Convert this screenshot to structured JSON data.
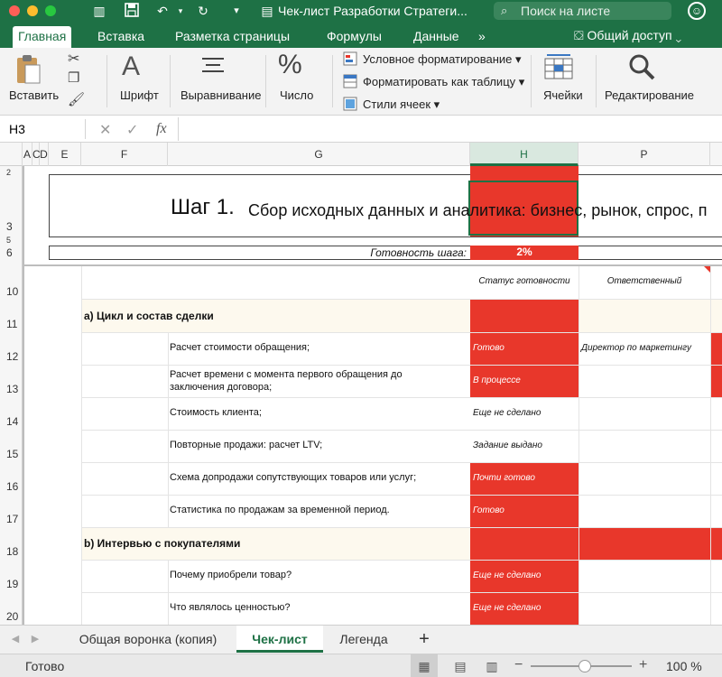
{
  "window": {
    "title": "Чек-лист Разработки Стратеги...",
    "search_placeholder": "Поиск на листе"
  },
  "ribbon_tabs": [
    "Главная",
    "Вставка",
    "Разметка страницы",
    "Формулы",
    "Данные",
    "»"
  ],
  "share_label": "Общий доступ",
  "ribbon": {
    "paste": "Вставить",
    "font": "Шрифт",
    "align": "Выравнивание",
    "number": "Число",
    "cond_format": "Условное форматирование",
    "format_table": "Форматировать как таблицу",
    "cell_styles": "Стили ячеек",
    "cells": "Ячейки",
    "editing": "Редактирование"
  },
  "formula_bar": {
    "name_box": "H3",
    "fx": "fx",
    "value": ""
  },
  "columns": [
    "A",
    "C",
    "D",
    "E",
    "F",
    "G",
    "H",
    "P"
  ],
  "sheet": {
    "heading_bold": "Шаг 1.",
    "heading_rest": "Сбор исходных данных и аналитика:  бизнес, рынок, спрос, п",
    "readiness_label": "Готовность шага:",
    "readiness_value": "2%",
    "col_status": "Статус готовности",
    "col_owner": "Ответственный",
    "section_a": "a) Цикл и состав сделки",
    "section_b": "b) Интервью с покупателями",
    "rows": [
      {
        "num": "12",
        "task": "Расчет стоимости обращения;",
        "status": "Готово",
        "owner": "Директор по маркетингу"
      },
      {
        "num": "13",
        "task": "Расчет времени с момента первого обращения до заключения договора;",
        "status": "В процессе",
        "owner": ""
      },
      {
        "num": "14",
        "task": "Стоимость клиента;",
        "status": "Еще не сделано",
        "owner": ""
      },
      {
        "num": "15",
        "task": "Повторные продажи: расчет LTV;",
        "status": "Задание выдано",
        "owner": ""
      },
      {
        "num": "16",
        "task": "Схема допродажи сопутствующих товаров или услуг;",
        "status": "Почти готово",
        "owner": ""
      },
      {
        "num": "17",
        "task": "Статистика по продажам за временной период.",
        "status": "Готово",
        "owner": ""
      },
      {
        "num": "19",
        "task": "Почему приобрели товар?",
        "status": "Еще не сделано",
        "owner": ""
      },
      {
        "num": "20",
        "task": "Что являлось ценностью?",
        "status": "Еще не сделано",
        "owner": ""
      }
    ],
    "row_numbers": [
      "2",
      "3",
      "5",
      "6",
      "10",
      "11",
      "12",
      "13",
      "14",
      "15",
      "16",
      "17",
      "18",
      "19",
      "20"
    ]
  },
  "sheet_tabs": [
    "Общая воронка (копия)",
    "Чек-лист",
    "Легенда",
    "+"
  ],
  "status_bar": {
    "ready": "Готово",
    "zoom": "100 %"
  },
  "colors": {
    "excel_green": "#1e7145",
    "status_red": "#e8372b"
  }
}
